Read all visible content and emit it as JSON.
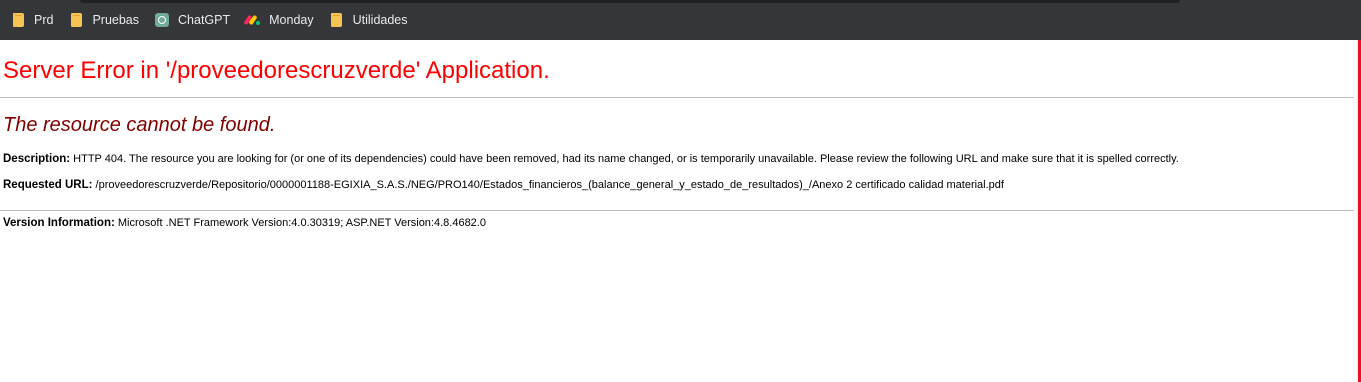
{
  "bookmarks": [
    {
      "label": "Prd",
      "icon": "folder-icon"
    },
    {
      "label": "Pruebas",
      "icon": "folder-icon"
    },
    {
      "label": "ChatGPT",
      "icon": "chatgpt-icon"
    },
    {
      "label": "Monday",
      "icon": "monday-icon"
    },
    {
      "label": "Utilidades",
      "icon": "folder-icon"
    }
  ],
  "error": {
    "title": "Server Error in '/proveedorescruzverde' Application.",
    "subtitle": "The resource cannot be found.",
    "description_label": "Description:",
    "description_text": "HTTP 404. The resource you are looking for (or one of its dependencies) could have been removed, had its name changed, or is temporarily unavailable.  Please review the following URL and make sure that it is spelled correctly.",
    "url_label": "Requested URL:",
    "url_text": "/proveedorescruzverde/Repositorio/0000001188-EGIXIA_S.A.S./NEG/PRO140/Estados_financieros_(balance_general_y_estado_de_resultados)_/Anexo 2 certificado calidad material.pdf",
    "version_label": "Version Information:",
    "version_text": "Microsoft .NET Framework Version:4.0.30319; ASP.NET Version:4.8.4682.0"
  },
  "colors": {
    "title": "#ff0000",
    "subtitle": "#800000",
    "bookmarks_bar": "#35363a",
    "folder": "#f5c453"
  }
}
